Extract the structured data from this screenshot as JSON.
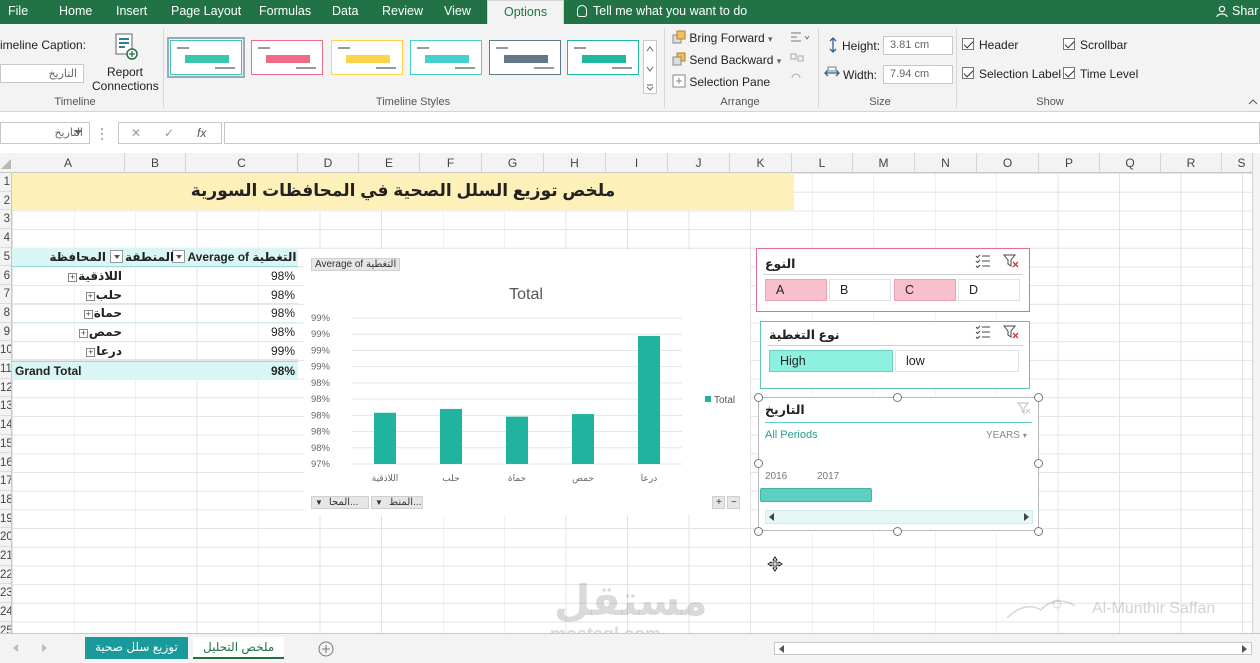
{
  "ribbon_tabs": [
    {
      "label": "File",
      "active": false
    },
    {
      "label": "Home",
      "active": false
    },
    {
      "label": "Insert",
      "active": false
    },
    {
      "label": "Page Layout",
      "active": false
    },
    {
      "label": "Formulas",
      "active": false
    },
    {
      "label": "Data",
      "active": false
    },
    {
      "label": "Review",
      "active": false
    },
    {
      "label": "View",
      "active": false
    },
    {
      "label": "Options",
      "active": true
    }
  ],
  "tell_me": "Tell me what you want to do",
  "share": "Shar",
  "ribbon": {
    "timeline_caption_label": "imeline Caption:",
    "timeline_caption_value": "التاريخ",
    "report_connections": "Report Connections",
    "group_timeline": "Timeline",
    "group_styles": "Timeline Styles",
    "style_colors": [
      "#3cc6b0",
      "#f06a8a",
      "#ffd44a",
      "#46d0cc",
      "#607888",
      "#20b8a0"
    ],
    "bring_forward": "Bring Forward",
    "send_backward": "Send Backward",
    "selection_pane": "Selection Pane",
    "group_arrange": "Arrange",
    "height_label": "Height:",
    "height_value": "3.81 cm",
    "width_label": "Width:",
    "width_value": "7.94 cm",
    "group_size": "Size",
    "show_header": "Header",
    "show_selection_label": "Selection Label",
    "show_scrollbar": "Scrollbar",
    "show_time_level": "Time Level",
    "group_show": "Show"
  },
  "formula_bar": {
    "name_box": "التاريخ",
    "cancel": "✕",
    "enter": "✓",
    "fx": "fx"
  },
  "columns": [
    "A",
    "B",
    "C",
    "D",
    "E",
    "F",
    "G",
    "H",
    "I",
    "J",
    "K",
    "L",
    "M",
    "N",
    "O",
    "P",
    "Q",
    "R",
    "S"
  ],
  "rows": [
    "1",
    "2",
    "3",
    "4",
    "5",
    "6",
    "7",
    "8",
    "9",
    "10",
    "11",
    "12",
    "13",
    "14",
    "15",
    "16",
    "17",
    "18",
    "19",
    "20",
    "21",
    "22",
    "23",
    "24",
    "25"
  ],
  "sheet_title": "ملخص توزيع السلل الصحية في المحافظات السورية",
  "pivot": {
    "header_governorate": "المحافظة",
    "header_region": "المنطقة",
    "header_average": "Average of التغطية",
    "rows": [
      {
        "name": "اللاذقية",
        "value": "98%"
      },
      {
        "name": "حلب",
        "value": "98%"
      },
      {
        "name": "حماة",
        "value": "98%"
      },
      {
        "name": "حمص",
        "value": "98%"
      },
      {
        "name": "درعا",
        "value": "99%"
      }
    ],
    "grand_label": "Grand Total",
    "grand_value": "98%"
  },
  "chart_buttons": {
    "value_field": "Average of التغطية",
    "axis_field_1": "المحا...",
    "axis_field_2": "المنط...",
    "plus": "+",
    "minus": "−"
  },
  "chart_data": {
    "type": "bar",
    "title": "Total",
    "categories": [
      "اللاذقية",
      "حلب",
      "حماة",
      "حمص",
      "درعا"
    ],
    "series": [
      {
        "name": "Total",
        "values": [
          97.85,
          97.88,
          97.82,
          97.84,
          98.45
        ]
      }
    ],
    "y_tick_labels": [
      "97%",
      "98%",
      "98%",
      "98%",
      "98%",
      "98%",
      "99%",
      "99%",
      "99%",
      "99%"
    ],
    "ylim": [
      97.45,
      98.59
    ],
    "bar_color": "#20b4a0",
    "legend": "right",
    "grid": true
  },
  "slicers": {
    "type": {
      "title": "النوع",
      "items": [
        {
          "label": "A",
          "selected": true
        },
        {
          "label": "B",
          "selected": false
        },
        {
          "label": "C",
          "selected": true
        },
        {
          "label": "D",
          "selected": false
        }
      ],
      "selected_color": "#f8bfcd"
    },
    "coverage": {
      "title": "نوع التغطية",
      "items": [
        {
          "label": "High",
          "selected": true
        },
        {
          "label": "low",
          "selected": false
        }
      ],
      "selected_color": "#8ef0de"
    }
  },
  "timeline": {
    "title": "التاريخ",
    "all_periods": "All Periods",
    "level": "YEARS",
    "years": [
      "2016",
      "2017"
    ],
    "accent": "#5ccfc0"
  },
  "sheet_tabs": [
    {
      "label": "توزيع سلل صحية",
      "active": false
    },
    {
      "label": "ملخص التحليل",
      "active": true
    }
  ],
  "watermark": {
    "brand": "مستقل",
    "site": "mostaql.com",
    "author": "Al-Munthir Saffan"
  }
}
